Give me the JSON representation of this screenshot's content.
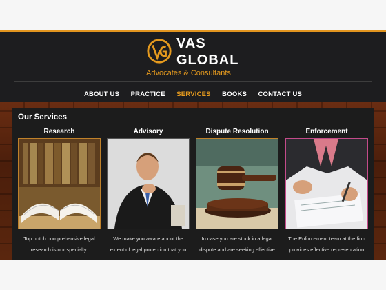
{
  "brand": {
    "line1": "VAS",
    "line2": "GLOBAL",
    "tagline": "Advocates & Consultants",
    "accent": "#e59a1e"
  },
  "nav": {
    "items": [
      {
        "label": "ABOUT US"
      },
      {
        "label": "PRACTICE"
      },
      {
        "label": "SERVICES",
        "active": true
      },
      {
        "label": "BOOKS"
      },
      {
        "label": "CONTACT US"
      }
    ]
  },
  "services": {
    "title": "Our Services",
    "items": [
      {
        "title": "Research",
        "image": "open-book-library-photo",
        "text1": "Top notch comprehensive legal",
        "text2": "research is our specialty."
      },
      {
        "title": "Advisory",
        "image": "lawyer-portrait-photo",
        "text1": "We make you aware about the",
        "text2": "extent of legal protection that you"
      },
      {
        "title": "Dispute Resolution",
        "image": "gavel-photo",
        "text1": "In case you are stuck in a legal",
        "text2": "dispute and are seeking effective"
      },
      {
        "title": "Enforcement",
        "image": "document-signing-photo",
        "text1": "The Enforcement team at the firm",
        "text2": "provides effective representation"
      }
    ]
  }
}
